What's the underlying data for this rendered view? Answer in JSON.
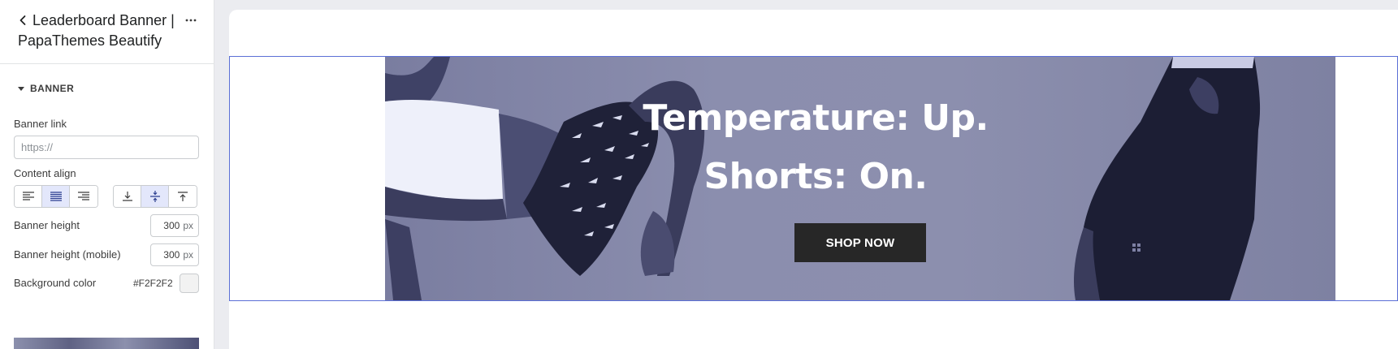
{
  "sidebar": {
    "title": "Leaderboard Banner | PapaThemes Beautify",
    "section_label": "BANNER",
    "banner_link": {
      "label": "Banner link",
      "placeholder": "https://"
    },
    "content_align": {
      "label": "Content align",
      "horizontal": [
        {
          "icon": "align-left-icon",
          "active": false
        },
        {
          "icon": "align-center-icon",
          "active": true
        },
        {
          "icon": "align-right-icon",
          "active": false
        }
      ],
      "vertical": [
        {
          "icon": "align-bottom-icon",
          "active": false
        },
        {
          "icon": "align-middle-icon",
          "active": true
        },
        {
          "icon": "align-top-icon",
          "active": false
        }
      ]
    },
    "banner_height": {
      "label": "Banner height",
      "value": "300",
      "unit": "px"
    },
    "banner_height_mobile": {
      "label": "Banner height (mobile)",
      "value": "300",
      "unit": "px"
    },
    "background_color": {
      "label": "Background color",
      "value": "#F2F2F2",
      "swatch": "#F2F2F2"
    }
  },
  "preview": {
    "headline_1": "Temperature: Up.",
    "headline_2": "Shorts: On.",
    "button_label": "SHOP NOW",
    "colors": {
      "banner_bg": "#8b8eae",
      "button_bg": "#272727",
      "selection_border": "#5b6fd6"
    }
  }
}
